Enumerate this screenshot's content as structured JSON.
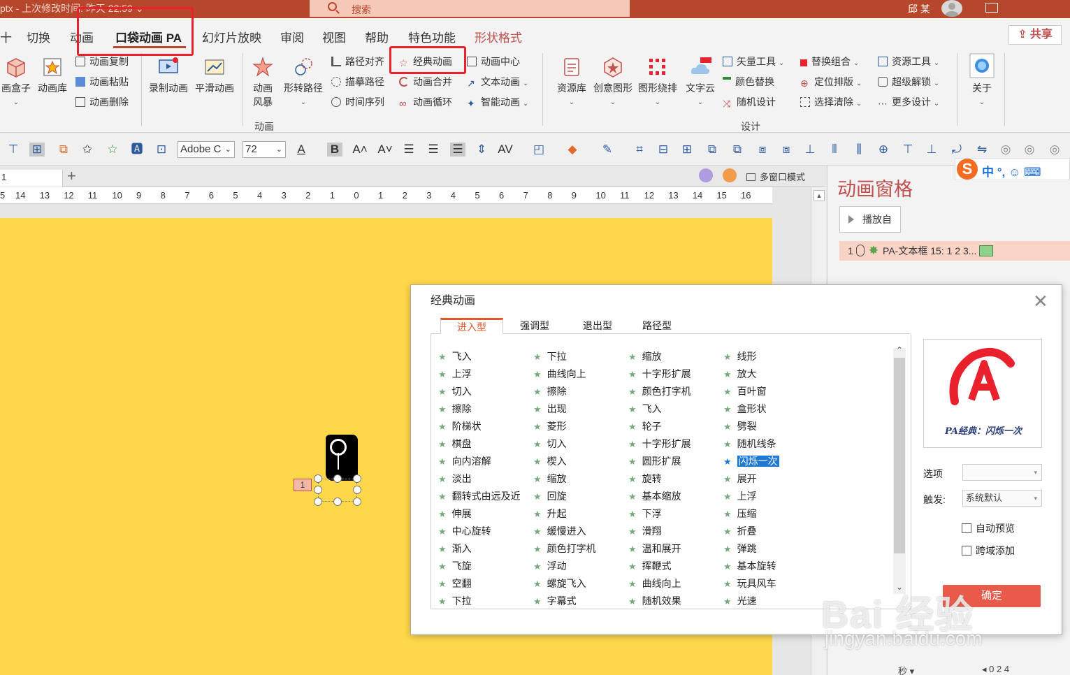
{
  "titlebar": {
    "title": "ptx  -  上次修改时间: 昨天 22:59  ⌄",
    "search_placeholder": "搜索",
    "user": "邱 某"
  },
  "tabs": [
    {
      "label": "十"
    },
    {
      "label": "切换"
    },
    {
      "label": "动画"
    },
    {
      "label": "口袋动画 PA",
      "active": true
    },
    {
      "label": "幻灯片放映"
    },
    {
      "label": "审阅"
    },
    {
      "label": "视图"
    },
    {
      "label": "帮助"
    },
    {
      "label": "特色功能"
    },
    {
      "label": "形状格式"
    }
  ],
  "share_label": "共享",
  "ribbon": {
    "b_box": "画盒子",
    "b_lib": "动画库",
    "s_copy": "动画复制",
    "s_paste": "动画粘贴",
    "s_delete": "动画删除",
    "b_record": "录制动画",
    "b_smooth": "平滑动画",
    "b_storm": "动画\n风暴",
    "b_shape_path": "形转路径",
    "s_path_align": "路径对齐",
    "s_trace_path": "描摹路径",
    "s_timeline": "时间序列",
    "s_classic": "经典动画",
    "s_merge": "动画合并",
    "s_loop": "动画循环",
    "s_center": "动画中心",
    "s_text_anim": "文本动画",
    "s_smart": "智能动画",
    "group_anim": "动画",
    "b_res": "资源库",
    "b_creative": "创意图形",
    "b_wrap": "图形绕排",
    "b_wordcloud": "文字云",
    "s_vector": "矢量工具",
    "s_color_replace": "颜色替换",
    "s_random": "随机设计",
    "s_replace_combo": "替换组合",
    "s_position": "定位排版",
    "s_select_clear": "选择清除",
    "s_res_tool": "资源工具",
    "s_super_unlock": "超级解锁",
    "s_more_design": "更多设计",
    "group_design": "设计",
    "b_about": "关于"
  },
  "format": {
    "font_name": "Adobe C",
    "font_size": "72"
  },
  "tabstrip": {
    "tab_name": "1",
    "multiwin": "多窗口模式"
  },
  "ruler": [
    "5",
    "14",
    "13",
    "12",
    "11",
    "10",
    "9",
    "8",
    "7",
    "6",
    "5",
    "4",
    "3",
    "2",
    "1",
    "0",
    "1",
    "2",
    "3",
    "4",
    "5",
    "6",
    "7",
    "8",
    "9",
    "10",
    "11",
    "12",
    "13",
    "14",
    "15",
    "16"
  ],
  "slide": {
    "badge": "1"
  },
  "animpane": {
    "title": "动画窗格",
    "play": "播放自",
    "item": "PA-文本框 15: 1 2 3...",
    "item_index": "1",
    "ime_text": "中 °, ☺ ⌨",
    "bottom_left": "秒 ▾",
    "bottom_right": "◂ 0    2    4"
  },
  "dialog": {
    "title": "经典动画",
    "tabs": [
      "进入型",
      "强调型",
      "退出型",
      "路径型"
    ],
    "col1": [
      "飞入",
      "上浮",
      "切入",
      "擦除",
      "阶梯状",
      "棋盘",
      "向内溶解",
      "淡出",
      "翻转式由远及近",
      "伸展",
      "中心旋转",
      "渐入",
      "飞旋",
      "空翻",
      "下拉"
    ],
    "col2": [
      "下拉",
      "曲线向上",
      "擦除",
      "出现",
      "菱形",
      "切入",
      "楔入",
      "缩放",
      "回旋",
      "升起",
      "缓慢进入",
      "颜色打字机",
      "浮动",
      "螺旋飞入",
      "字幕式"
    ],
    "col3": [
      "缩放",
      "十字形扩展",
      "颜色打字机",
      "飞入",
      "轮子",
      "十字形扩展",
      "圆形扩展",
      "旋转",
      "基本缩放",
      "下浮",
      "滑翔",
      "温和展开",
      "挥鞭式",
      "曲线向上",
      "随机效果"
    ],
    "col4": [
      "线形",
      "放大",
      "百叶窗",
      "盒形状",
      "劈裂",
      "随机线条",
      "闪烁一次",
      "展开",
      "上浮",
      "压缩",
      "折叠",
      "弹跳",
      "基本旋转",
      "玩具风车",
      "光速"
    ],
    "selected": "闪烁一次",
    "preview_caption": "PA经典：闪烁一次",
    "opt_label": "选项",
    "trigger_label": "触发:",
    "trigger_value": "系统默认",
    "auto_preview": "自动预览",
    "cross_add": "跨域添加",
    "ok": "确定"
  },
  "watermark": {
    "brand": "Bai 经验",
    "url": "jingyan.baidu.com"
  }
}
